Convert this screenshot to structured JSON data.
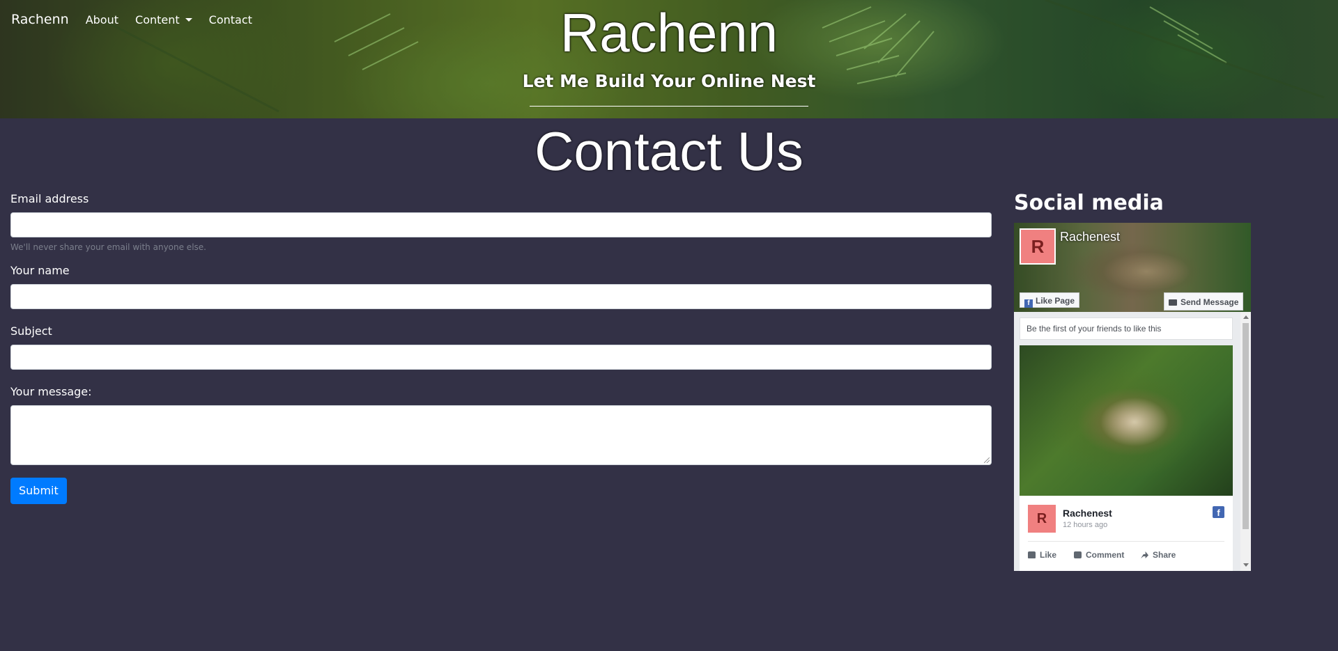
{
  "nav": {
    "brand": "Rachenn",
    "links": [
      "About",
      "Content",
      "Contact"
    ]
  },
  "hero": {
    "title": "Rachenn",
    "subtitle": "Let Me Build Your Online Nest"
  },
  "page_title": "Contact Us",
  "form": {
    "email_label": "Email address",
    "email_value": "",
    "email_help": "We'll never share your email with anyone else.",
    "name_label": "Your name",
    "name_value": "",
    "subject_label": "Subject",
    "subject_value": "",
    "message_label": "Your message:",
    "message_value": "",
    "submit_label": "Submit"
  },
  "social": {
    "title": "Social media",
    "page_name": "Rachenest",
    "avatar_letter": "R",
    "like_page": "Like Page",
    "send_message": "Send Message",
    "friends_text": "Be the first of your friends to like this",
    "post": {
      "author": "Rachenest",
      "time": "12 hours ago",
      "like": "Like",
      "comment": "Comment",
      "share": "Share"
    }
  },
  "colors": {
    "background": "#333146",
    "submit": "#007bff",
    "facebook": "#4267b2",
    "avatar": "#f08080"
  }
}
